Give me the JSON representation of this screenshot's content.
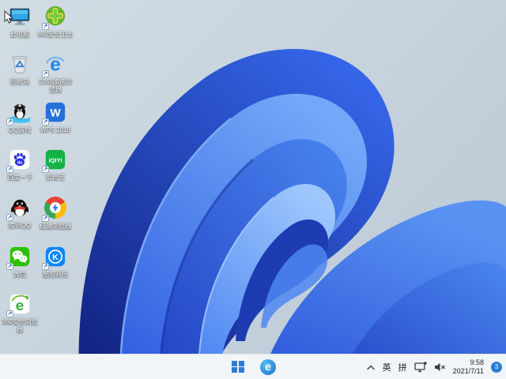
{
  "desktop": {
    "icons": [
      {
        "label": "此电脑",
        "icon": "this-pc-icon",
        "shortcut": false
      },
      {
        "label": "360安全卫士",
        "icon": "360-safety-icon",
        "shortcut": true
      },
      {
        "label": "回收站",
        "icon": "recycle-bin-icon",
        "shortcut": false
      },
      {
        "label": "2345加速浏览器",
        "icon": "2345-browser-icon",
        "shortcut": true,
        "glyph_text": "e"
      },
      {
        "label": "QQ游戏",
        "icon": "qq-games-icon",
        "shortcut": true
      },
      {
        "label": "WPS 2019",
        "icon": "wps-2019-icon",
        "shortcut": true,
        "glyph_text": "W"
      },
      {
        "label": "百度一下",
        "icon": "baidu-icon",
        "shortcut": true,
        "glyph_text": "du"
      },
      {
        "label": "爱奇艺",
        "icon": "iqiyi-icon",
        "shortcut": true,
        "glyph_text": "iQIYI"
      },
      {
        "label": "腾讯QQ",
        "icon": "tencent-qq-icon",
        "shortcut": true
      },
      {
        "label": "极速浏览器",
        "icon": "speed-browser-icon",
        "shortcut": true
      },
      {
        "label": "微信",
        "icon": "wechat-icon",
        "shortcut": true
      },
      {
        "label": "酷狗音乐",
        "icon": "kugou-music-icon",
        "shortcut": true,
        "glyph_text": "K"
      },
      {
        "label": "360安全浏览器",
        "icon": "360-safe-browser-icon",
        "shortcut": true,
        "glyph_text": "e"
      }
    ]
  },
  "taskbar": {
    "pinned_browser_glyph": "e",
    "ime_english": "英",
    "ime_pinyin": "拼",
    "clock": {
      "time": "9:58",
      "date": "2021/7/11"
    },
    "notification_count": "3"
  },
  "colors": {
    "taskbar_bg": "#f2f5f8",
    "start_blue": "#2e7cd6",
    "badge_blue": "#2b7fd6",
    "bloom_dark": "#16288f",
    "bloom_bright": "#4485f5",
    "background_light": "#ccd7df"
  }
}
